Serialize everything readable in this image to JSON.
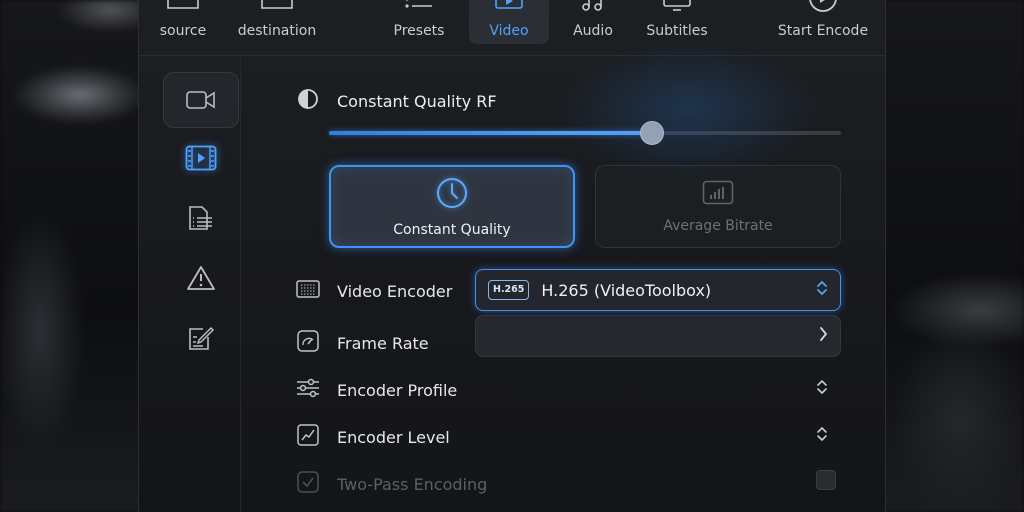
{
  "toolbar": {
    "items": [
      {
        "label": "source",
        "icon": "folder-icon"
      },
      {
        "label": "destination",
        "icon": "folder-icon"
      },
      {
        "label": "Presets",
        "icon": "list-icon"
      },
      {
        "label": "Video",
        "icon": "video-frame-icon",
        "active": true
      },
      {
        "label": "Audio",
        "icon": "music-note-icon"
      },
      {
        "label": "Subtitles",
        "icon": "monitor-icon"
      },
      {
        "label": "Start Encode",
        "icon": "play-circle-icon"
      }
    ]
  },
  "sidebar": {
    "items": [
      {
        "icon": "video-camera-icon",
        "selected": true
      },
      {
        "icon": "film-strip-icon",
        "accent": true
      },
      {
        "icon": "document-list-icon"
      },
      {
        "icon": "warning-icon"
      },
      {
        "icon": "edit-icon"
      }
    ]
  },
  "quality": {
    "label": "Constant Quality RF",
    "slider_value_fraction": 0.63
  },
  "modes": {
    "constant_quality": "Constant Quality",
    "average_bitrate": "Average Bitrate",
    "selected": "constant_quality"
  },
  "fields": {
    "video_encoder": {
      "label": "Video Encoder",
      "badge": "H.265",
      "value": "H.265 (VideoToolbox)"
    },
    "frame_rate": {
      "label": "Frame Rate",
      "value": ""
    },
    "encoder_profile": {
      "label": "Encoder Profile"
    },
    "encoder_level": {
      "label": "Encoder Level"
    },
    "two_pass": {
      "label": "Two-Pass Encoding",
      "checked": false,
      "enabled": false
    }
  },
  "colors": {
    "accent": "#3d95f0",
    "active_tab_text": "#4ea3ff",
    "window_bg": "#1d1f23",
    "disabled_text": "#5b5f66"
  }
}
